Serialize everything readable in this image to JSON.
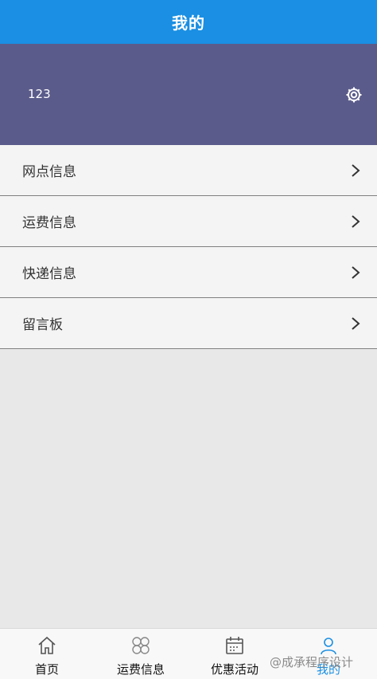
{
  "header": {
    "title": "我的"
  },
  "profile": {
    "username": "123",
    "settings_icon": "gear-icon"
  },
  "menu": {
    "items": [
      {
        "label": "网点信息",
        "icon": "chevron-right-icon"
      },
      {
        "label": "运费信息",
        "icon": "chevron-right-icon"
      },
      {
        "label": "快递信息",
        "icon": "chevron-right-icon"
      },
      {
        "label": "留言板",
        "icon": "chevron-right-icon"
      }
    ]
  },
  "tabbar": {
    "tabs": [
      {
        "label": "首页",
        "icon": "home-icon"
      },
      {
        "label": "运费信息",
        "icon": "grid-icon"
      },
      {
        "label": "优惠活动",
        "icon": "calendar-icon"
      },
      {
        "label": "我的",
        "icon": "user-icon"
      }
    ]
  },
  "watermark": "@成承程序设计",
  "colors": {
    "header_bg": "#1a8fe3",
    "profile_bg": "#5b5b8b",
    "menu_bg": "#f4f4f4",
    "page_bg": "#e8e8e8",
    "accent": "#1a8fe3"
  }
}
